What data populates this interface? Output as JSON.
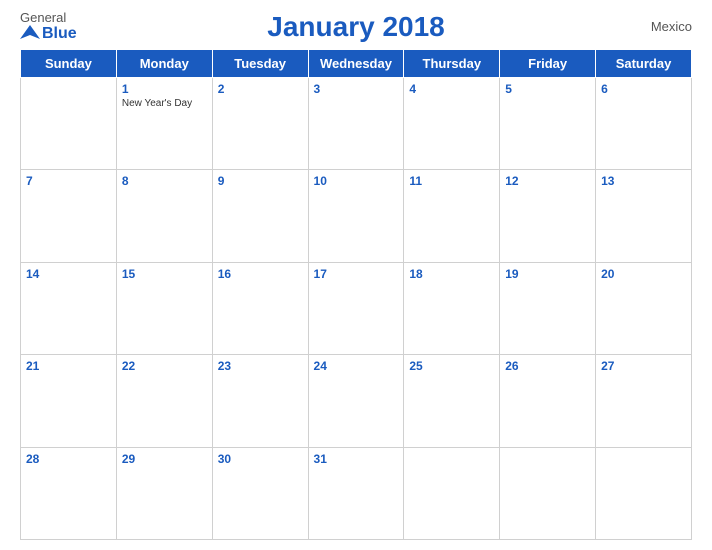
{
  "header": {
    "logo": {
      "general": "General",
      "blue": "Blue"
    },
    "title": "January 2018",
    "country": "Mexico"
  },
  "weekdays": [
    "Sunday",
    "Monday",
    "Tuesday",
    "Wednesday",
    "Thursday",
    "Friday",
    "Saturday"
  ],
  "weeks": [
    [
      {
        "day": "",
        "empty": true
      },
      {
        "day": "1",
        "holiday": "New Year's Day"
      },
      {
        "day": "2",
        "holiday": ""
      },
      {
        "day": "3",
        "holiday": ""
      },
      {
        "day": "4",
        "holiday": ""
      },
      {
        "day": "5",
        "holiday": ""
      },
      {
        "day": "6",
        "holiday": ""
      }
    ],
    [
      {
        "day": "7",
        "holiday": ""
      },
      {
        "day": "8",
        "holiday": ""
      },
      {
        "day": "9",
        "holiday": ""
      },
      {
        "day": "10",
        "holiday": ""
      },
      {
        "day": "11",
        "holiday": ""
      },
      {
        "day": "12",
        "holiday": ""
      },
      {
        "day": "13",
        "holiday": ""
      }
    ],
    [
      {
        "day": "14",
        "holiday": ""
      },
      {
        "day": "15",
        "holiday": ""
      },
      {
        "day": "16",
        "holiday": ""
      },
      {
        "day": "17",
        "holiday": ""
      },
      {
        "day": "18",
        "holiday": ""
      },
      {
        "day": "19",
        "holiday": ""
      },
      {
        "day": "20",
        "holiday": ""
      }
    ],
    [
      {
        "day": "21",
        "holiday": ""
      },
      {
        "day": "22",
        "holiday": ""
      },
      {
        "day": "23",
        "holiday": ""
      },
      {
        "day": "24",
        "holiday": ""
      },
      {
        "day": "25",
        "holiday": ""
      },
      {
        "day": "26",
        "holiday": ""
      },
      {
        "day": "27",
        "holiday": ""
      }
    ],
    [
      {
        "day": "28",
        "holiday": ""
      },
      {
        "day": "29",
        "holiday": ""
      },
      {
        "day": "30",
        "holiday": ""
      },
      {
        "day": "31",
        "holiday": ""
      },
      {
        "day": "",
        "empty": true
      },
      {
        "day": "",
        "empty": true
      },
      {
        "day": "",
        "empty": true
      }
    ]
  ]
}
